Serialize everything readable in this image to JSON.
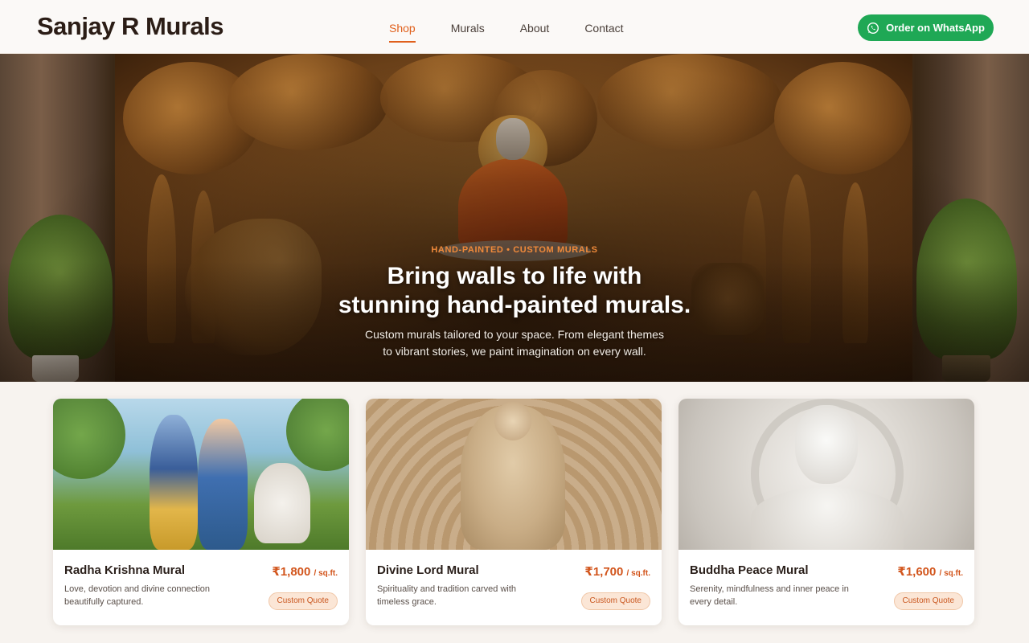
{
  "header": {
    "logo": "Sanjay R Murals",
    "nav": [
      "Shop",
      "Murals",
      "About",
      "Contact"
    ],
    "active_nav": "Shop",
    "whatsapp_label": "Order on WhatsApp",
    "whatsapp_icon": "whatsapp-icon",
    "colors": {
      "accent": "#e0601c",
      "whatsapp": "#1fa855"
    }
  },
  "hero": {
    "eyebrow": "HAND-PAINTED • CUSTOM MURALS",
    "title_line1": "Bring walls to life with",
    "title_line2": "stunning hand-painted murals.",
    "subtitle_line1": "Custom murals tailored to your space. From elegant themes",
    "subtitle_line2": "to vibrant stories, we paint imagination on every wall."
  },
  "products": [
    {
      "title": "Radha Krishna Mural",
      "price": "₹1,800",
      "unit": "/ sq.ft.",
      "desc": "Love, devotion and divine connection beautifully captured.",
      "cta": "Custom Quote"
    },
    {
      "title": "Divine Lord Mural",
      "price": "₹1,700",
      "unit": "/ sq.ft.",
      "desc": "Spirituality and tradition carved with timeless grace.",
      "cta": "Custom Quote"
    },
    {
      "title": "Buddha Peace Mural",
      "price": "₹1,600",
      "unit": "/ sq.ft.",
      "desc": "Serenity, mindfulness and inner peace in every detail.",
      "cta": "Custom Quote"
    }
  ]
}
